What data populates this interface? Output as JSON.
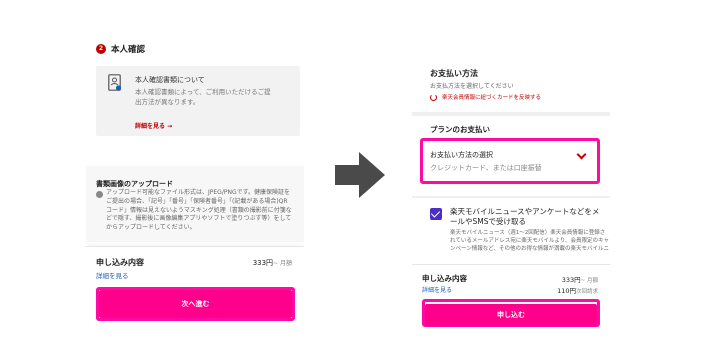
{
  "left": {
    "section_number": "2",
    "section_title": "本人確認",
    "info": {
      "title": "本人確認書類について",
      "body": "本人確認書類によって、ご利用いただけるご提出方法が異なります。",
      "link": "詳細を見る →"
    },
    "upload": {
      "title": "書類画像のアップロード",
      "body": "アップロード可能なファイル形式は、JPEG/PNGです。健康保険証をご提出の場合、「記号」「番号」「保険者番号」「(記載がある場合)QRコード」情報は見えないようマスキング処理（書類の撮影前に付箋などで隠す、撮影後に画像編集アプリやソフトで塗りつぶす等）をしてからアップロードしてください。"
    },
    "summary": {
      "label": "申し込み内容",
      "link": "詳細を見る",
      "price": "333円",
      "price_unit": "~ 月額"
    },
    "next_button": "次へ進む"
  },
  "right": {
    "payment_title": "お支払い方法",
    "payment_sub": "お支払方法を選択してください",
    "payment_link": "楽天会員情報に紐づくカードを反映する",
    "plan_title": "プランのお支払い",
    "select_label": "お支払い方法の選択",
    "select_value": "クレジットカード、または口座振替",
    "option_title": "楽天モバイルニュースやアンケートなどをメールやSMSで受け取る",
    "option_body": "楽天モバイルニュース（週1〜2回配信）楽天会員情報に登録されているメールアドレス宛に楽天モバイルより、会員限定のキャンペーン情報など、その他のお得な情報が満載の楽天モバイルニ",
    "summary": {
      "label": "申し込み内容",
      "link": "詳細を見る",
      "price1": "333円",
      "price1_unit": "~ 月額",
      "price2": "110円",
      "price2_unit": "次回請求"
    },
    "submit_button": "申し込む"
  },
  "colors": {
    "brand_red": "#bf0000",
    "highlight_pink": "#ff0aa3",
    "button_pink": "#ff008c",
    "checkbox_purple": "#4a2fc7",
    "arrow_gray": "#4a4a4a"
  }
}
